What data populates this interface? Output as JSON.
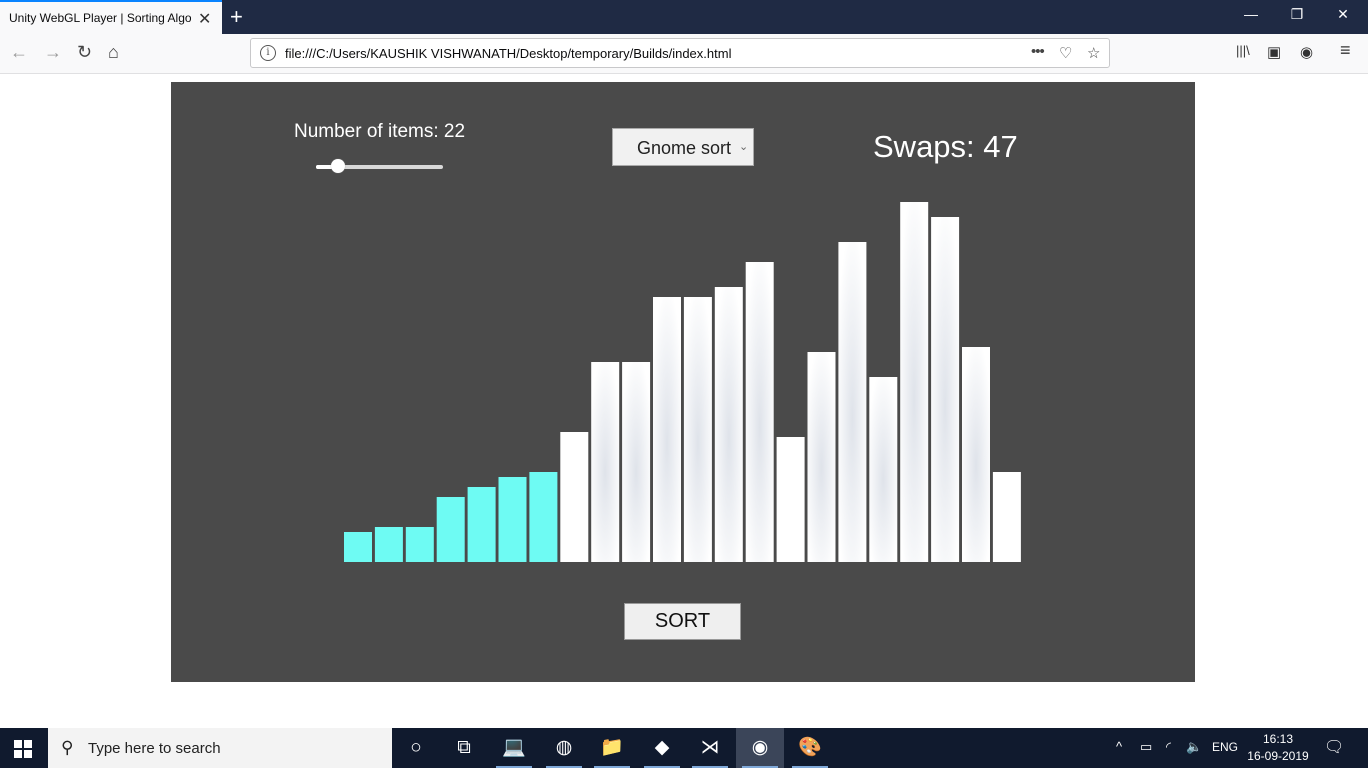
{
  "browser": {
    "tab_title": "Unity WebGL Player | Sorting Algorithms",
    "tab_close": "✕",
    "new_tab": "+",
    "url": "file:///C:/Users/KAUSHIK VISHWANATH/Desktop/temporary/Builds/index.html",
    "window_controls": {
      "minimize": "—",
      "restore": "❐",
      "close": "✕"
    },
    "nav": {
      "back": "←",
      "forward": "→",
      "reload": "↻",
      "home": "⌂"
    },
    "icons": {
      "menu_dots": "•••",
      "pocket": "♡",
      "bookmark": "☆",
      "library": "|||\\",
      "sidebar": "▣",
      "account": "◉",
      "hamburger": "≡"
    }
  },
  "app": {
    "items_label": "Number of items: 22",
    "items_slider_value": 0.17,
    "algorithm": "Gnome sort",
    "algorithm_chevron": "⌄",
    "swaps_label": "Swaps: 47",
    "sort_button": "SORT",
    "colors": {
      "sorted": "#6efbf3",
      "unsorted": "#ffffff",
      "background": "#4a4a4a"
    }
  },
  "chart_data": {
    "type": "bar",
    "count": 22,
    "values": [
      30,
      35,
      35,
      65,
      75,
      85,
      90,
      130,
      200,
      200,
      265,
      265,
      275,
      300,
      125,
      210,
      320,
      185,
      360,
      345,
      215,
      90
    ],
    "sorted_prefix": 7
  },
  "taskbar": {
    "search_placeholder": "Type here to search",
    "search_icon": "⚲",
    "apps": [
      {
        "name": "cortana",
        "glyph": "○"
      },
      {
        "name": "task-view",
        "glyph": "⧉"
      },
      {
        "name": "laptop-app",
        "glyph": "💻"
      },
      {
        "name": "chrome",
        "glyph": "◍"
      },
      {
        "name": "file-explorer",
        "glyph": "📁"
      },
      {
        "name": "git-app",
        "glyph": "◆"
      },
      {
        "name": "vscode",
        "glyph": "⋊"
      },
      {
        "name": "firefox",
        "glyph": "◉"
      },
      {
        "name": "paint",
        "glyph": "🎨"
      }
    ],
    "tray": {
      "chevron": "^",
      "battery": "▭",
      "network": "◜",
      "volume": "🔈",
      "language": "ENG"
    },
    "time": "16:13",
    "date": "16-09-2019",
    "notification": "🗨"
  }
}
